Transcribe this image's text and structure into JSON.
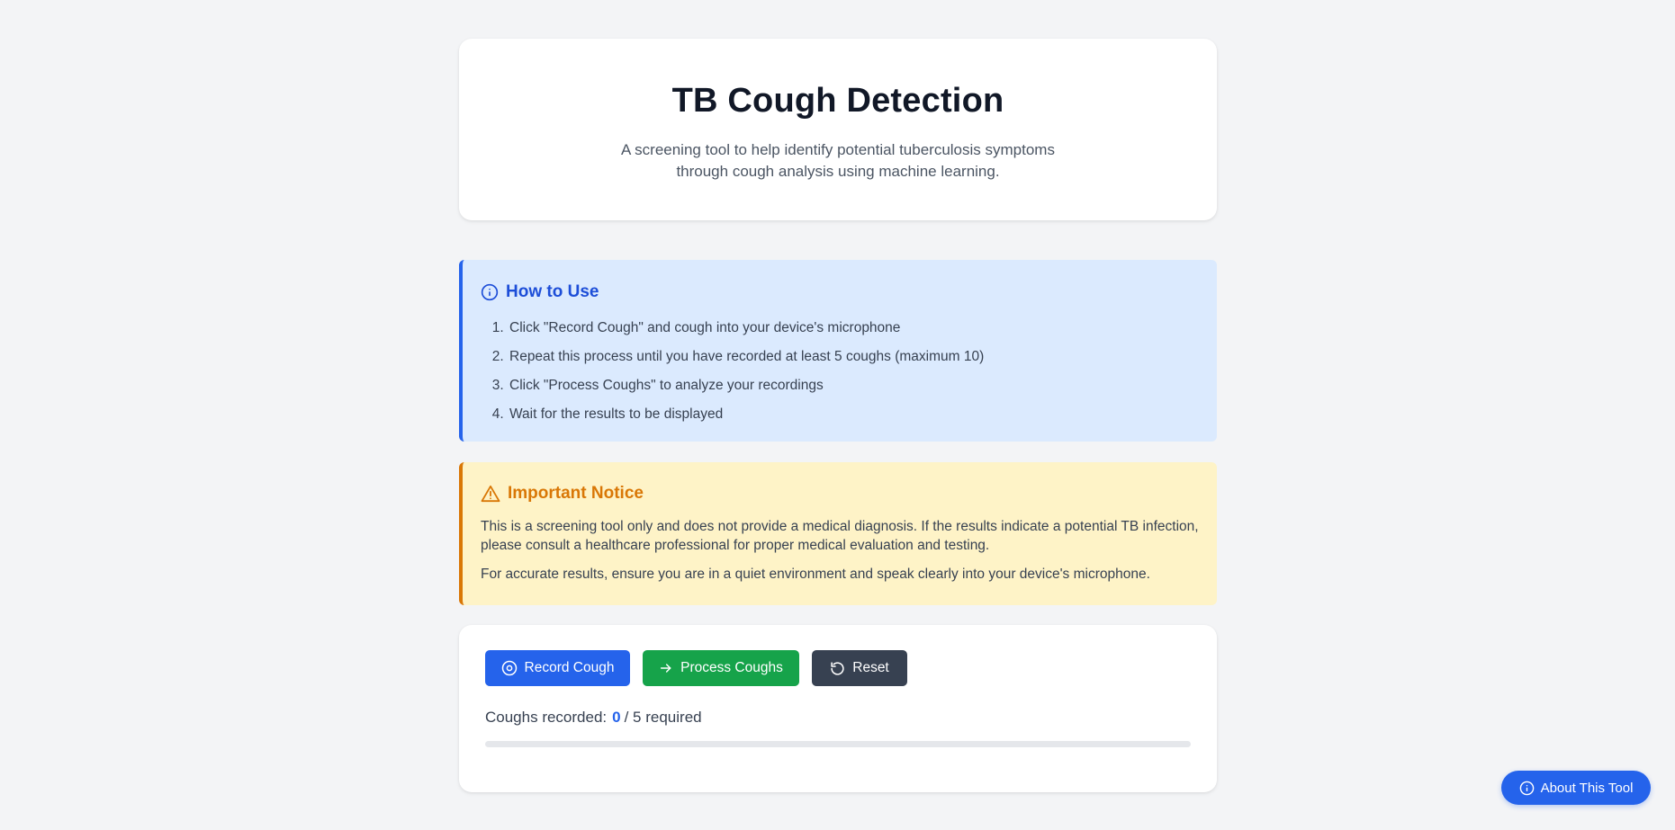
{
  "header": {
    "title": "TB Cough Detection",
    "subtitle": "A screening tool to help identify potential tuberculosis symptoms through cough analysis using machine learning."
  },
  "how_to_use": {
    "heading": "How to Use",
    "icon": "info-icon",
    "steps": [
      "Click \"Record Cough\" and cough into your device's microphone",
      "Repeat this process until you have recorded at least 5 coughs (maximum 10)",
      "Click \"Process Coughs\" to analyze your recordings",
      "Wait for the results to be displayed"
    ]
  },
  "notice": {
    "heading": "Important Notice",
    "icon": "warning-icon",
    "paragraphs": [
      "This is a screening tool only and does not provide a medical diagnosis. If the results indicate a potential TB infection, please consult a healthcare professional for proper medical evaluation and testing.",
      "For accurate results, ensure you are in a quiet environment and speak clearly into your device's microphone."
    ]
  },
  "controls": {
    "record_label": "Record Cough",
    "process_label": "Process Coughs",
    "reset_label": "Reset",
    "count_label": "Coughs recorded:",
    "count_value": "0",
    "count_suffix": "/ 5 required",
    "progress_fraction": 0
  },
  "about_label": "About This Tool",
  "colors": {
    "accent": "#2563eb",
    "success": "#16a34a",
    "dark": "#374151",
    "warning": "#d97706",
    "info_bg": "#dbeafe",
    "warning_bg": "#fef3c7",
    "page_bg": "#f3f4f6"
  }
}
